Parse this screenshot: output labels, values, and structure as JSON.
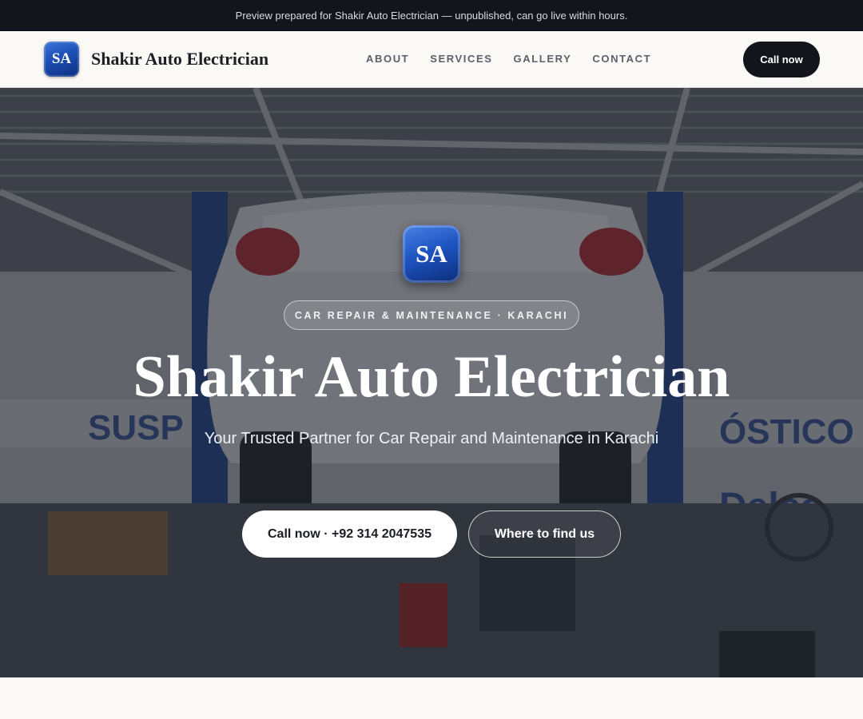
{
  "preview_banner": "Preview prepared for Shakir Auto Electrician — unpublished, can go live within hours.",
  "header": {
    "logo_initials": "SA",
    "brand_name": "Shakir Auto Electrician",
    "nav": [
      "ABOUT",
      "SERVICES",
      "GALLERY",
      "CONTACT"
    ],
    "call_label": "Call now"
  },
  "hero": {
    "badge_initials": "SA",
    "eyebrow": "CAR REPAIR & MAINTENANCE · KARACHI",
    "title": "Shakir Auto Electrician",
    "subtitle": "Your Trusted Partner for Car Repair and Maintenance in Karachi",
    "primary_cta": "Call now · +92 314 2047535",
    "secondary_cta": "Where to find us",
    "background_image": "garage-car-on-lift-photo"
  },
  "colors": {
    "dark": "#13151c",
    "badge_blue": "#1c4fb4",
    "page_bg": "#faf9f6"
  }
}
